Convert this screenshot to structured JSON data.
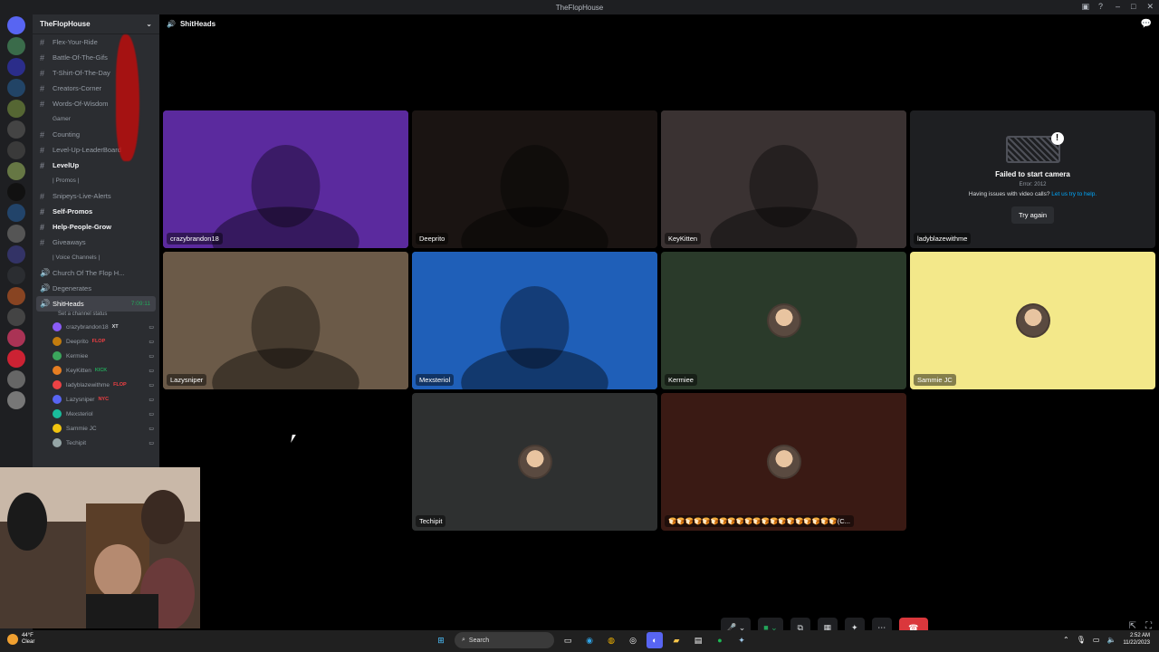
{
  "window": {
    "title": "TheFlopHouse"
  },
  "server": {
    "name": "TheFlopHouse"
  },
  "channels": [
    {
      "label": "Flex-Your-Ride",
      "type": "text",
      "bold": false
    },
    {
      "label": "Battle-Of-The-Gifs",
      "type": "text",
      "bold": false
    },
    {
      "label": "T-Shirt-Of-The-Day",
      "type": "text",
      "bold": false
    },
    {
      "label": "Creators-Corner",
      "type": "text",
      "bold": false
    },
    {
      "label": "Words-Of-Wisdom",
      "type": "text",
      "bold": false
    },
    {
      "label": "Gamer",
      "type": "category"
    },
    {
      "label": "Counting",
      "type": "text",
      "bold": false
    },
    {
      "label": "Level-Up-LeaderBoard",
      "type": "text",
      "bold": false
    },
    {
      "label": "LevelUp",
      "type": "text",
      "bold": true
    },
    {
      "label": "| Promos |",
      "type": "category"
    },
    {
      "label": "Snipeys-Live-Alerts",
      "type": "text",
      "bold": false
    },
    {
      "label": "Self-Promos",
      "type": "text",
      "bold": true
    },
    {
      "label": "Help-People-Grow",
      "type": "text",
      "bold": true
    },
    {
      "label": "Giveaways",
      "type": "text",
      "bold": false
    },
    {
      "label": "| Voice Channels |",
      "type": "category"
    },
    {
      "label": "Church Of The Flop H...",
      "type": "voice",
      "bold": false
    },
    {
      "label": "Degenerates",
      "type": "voice",
      "bold": false
    }
  ],
  "active_voice": {
    "label": "ShitHeads",
    "timer": "7:09:11",
    "status": "Set a channel status"
  },
  "members": [
    {
      "name": "crazybrandon18",
      "tag": "XT",
      "tag_color": "#dbdee1",
      "color": "#8b5cf6"
    },
    {
      "name": "Deeprito",
      "tag": "FLOP",
      "tag_color": "#f23f43",
      "color": "#c27c0e"
    },
    {
      "name": "Kermiee",
      "tag": "",
      "tag_color": "",
      "color": "#3ba55c"
    },
    {
      "name": "KeyKitten",
      "tag": "KICK",
      "tag_color": "#23a55a",
      "color": "#e67e22"
    },
    {
      "name": "ladyblazewithme",
      "tag": "FLOP",
      "tag_color": "#f23f43",
      "color": "#ed4245"
    },
    {
      "name": "Lazysniper",
      "tag": "NYC",
      "tag_color": "#f23f43",
      "color": "#5865f2"
    },
    {
      "name": "Mexsteriol",
      "tag": "",
      "tag_color": "",
      "color": "#1abc9c"
    },
    {
      "name": "Sammie JC",
      "tag": "",
      "tag_color": "",
      "color": "#f1c40f"
    },
    {
      "name": "Techipit",
      "tag": "",
      "tag_color": "",
      "color": "#95a5a6"
    }
  ],
  "call": {
    "channel": "ShitHeads",
    "tiles": [
      {
        "name": "crazybrandon18",
        "kind": "video",
        "bg": "#5b2a9e"
      },
      {
        "name": "Deeprito",
        "kind": "video",
        "bg": "#1a1412"
      },
      {
        "name": "KeyKitten",
        "kind": "video",
        "bg": "#3a3232"
      },
      {
        "name": "ladyblazewithme",
        "kind": "camfail",
        "bg": "#1e1f22"
      },
      {
        "name": "Lazysniper",
        "kind": "video",
        "bg": "#6b5a48"
      },
      {
        "name": "Mexsteriol",
        "kind": "video",
        "bg": "#1f5fb8"
      },
      {
        "name": "Kermiee",
        "kind": "avatar",
        "bg": "#2a3a2a"
      },
      {
        "name": "Sammie JC",
        "kind": "avatar",
        "bg": "#f3e88a"
      },
      {
        "name": "Techipit",
        "kind": "avatar",
        "bg": "#2e3030"
      },
      {
        "name": "🍞🍞🍞🍞🍞🍞🍞🍞🍞🍞🍞🍞🍞🍞🍞🍞🍞🍞🍞🍞(C...",
        "kind": "avatar",
        "bg": "#3a1a14"
      }
    ],
    "camera_fail": {
      "title": "Failed to start camera",
      "error": "Error: 2012",
      "help_prefix": "Having issues with video calls?",
      "help_link": "Let us try to help.",
      "button": "Try again"
    }
  },
  "taskbar": {
    "weather_temp": "44°F",
    "weather_cond": "Clear",
    "search": "Search",
    "time": "2:52 AM",
    "date": "11/22/2023"
  }
}
